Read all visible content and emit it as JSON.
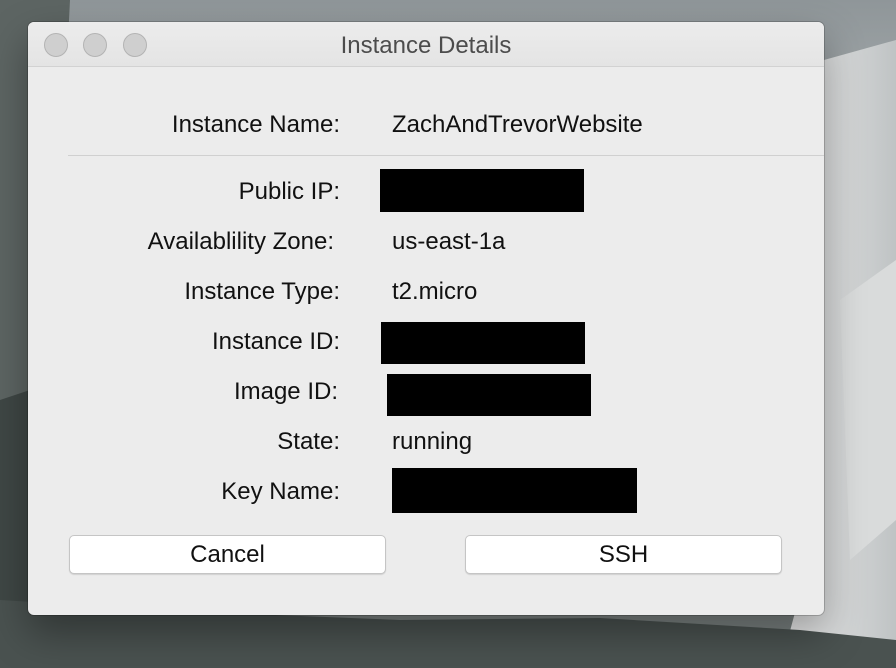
{
  "window": {
    "title": "Instance Details"
  },
  "fields": {
    "instance_name": {
      "label": "Instance Name:",
      "value": "ZachAndTrevorWebsite"
    },
    "public_ip": {
      "label": "Public IP:",
      "value": ""
    },
    "availability_zone": {
      "label": "Availablility Zone:",
      "value": "us-east-1a"
    },
    "instance_type": {
      "label": "Instance Type:",
      "value": "t2.micro"
    },
    "instance_id": {
      "label": "Instance ID:",
      "value": ""
    },
    "image_id": {
      "label": "Image ID:",
      "value": ""
    },
    "state": {
      "label": "State:",
      "value": "running"
    },
    "key_name": {
      "label": "Key Name:",
      "value": ""
    }
  },
  "buttons": {
    "cancel": "Cancel",
    "ssh": "SSH"
  },
  "colors": {
    "window_bg": "#ececec",
    "redaction": "#000000",
    "button_bg": "#ffffff"
  }
}
